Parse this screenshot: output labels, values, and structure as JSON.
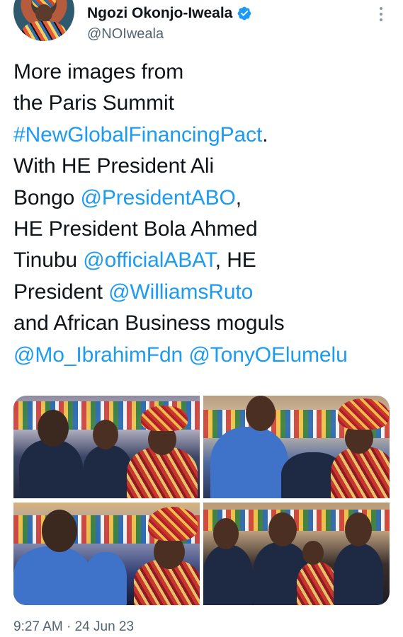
{
  "author": {
    "name": "Ngozi Okonjo-Iweala",
    "handle": "@NOIweala",
    "verified_icon": "verified-badge-icon",
    "menu_icon": "more-vertical-icon"
  },
  "tweet": {
    "lines": [
      [
        {
          "t": "More images from",
          "link": false
        }
      ],
      [
        {
          "t": "the Paris Summit",
          "link": false
        }
      ],
      [
        {
          "t": "#NewGlobalFinancingPact",
          "link": true
        },
        {
          "t": ".",
          "link": false
        }
      ],
      [
        {
          "t": "With HE President Ali",
          "link": false
        }
      ],
      [
        {
          "t": "Bongo ",
          "link": false
        },
        {
          "t": "@PresidentABO",
          "link": true
        },
        {
          "t": ",",
          "link": false
        }
      ],
      [
        {
          "t": "HE President Bola Ahmed",
          "link": false
        }
      ],
      [
        {
          "t": "Tinubu ",
          "link": false
        },
        {
          "t": "@officialABAT",
          "link": true
        },
        {
          "t": ", HE",
          "link": false
        }
      ],
      [
        {
          "t": "President ",
          "link": false
        },
        {
          "t": "@WilliamsRuto",
          "link": true
        }
      ],
      [
        {
          "t": "and African Business moguls",
          "link": false
        }
      ],
      [
        {
          "t": "@Mo_IbrahimFdn",
          "link": true
        },
        {
          "t": " ",
          "link": false
        },
        {
          "t": "@TonyOElumelu",
          "link": true
        }
      ]
    ]
  },
  "media": {
    "photos": [
      "photo-1",
      "photo-2",
      "photo-3",
      "photo-4"
    ]
  },
  "timestamp": "9:27 AM · 24 Jun 23",
  "colors": {
    "link": "#1d9bf0",
    "text": "#0f1419",
    "secondary": "#536471"
  }
}
